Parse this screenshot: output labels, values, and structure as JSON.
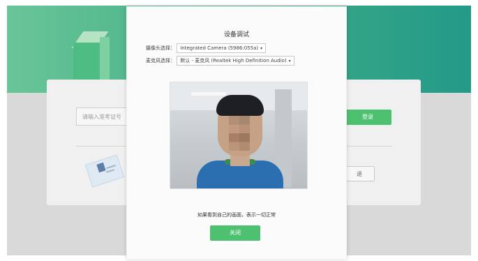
{
  "login": {
    "ticket_placeholder": "请输入准考证号",
    "login_button": "登录",
    "secondary_button": "退"
  },
  "modal": {
    "title": "设备调试",
    "camera_label": "摄像头选择：",
    "camera_value": "Integrated Camera (5986:055a)",
    "mic_label": "麦克风选择：",
    "mic_value": "默认 - 麦克风 (Realtek High Definition Audio)",
    "hint": "如果看到自己的画面，表示一切正常",
    "close_button": "关闭"
  },
  "colors": {
    "accent": "#4dc16f",
    "header_gradient_start": "#69c598",
    "header_gradient_end": "#239a89"
  },
  "icons": {
    "select_caret": "caret-down-icon",
    "id_card": "id-card-icon",
    "deco_box": "box-icon"
  }
}
